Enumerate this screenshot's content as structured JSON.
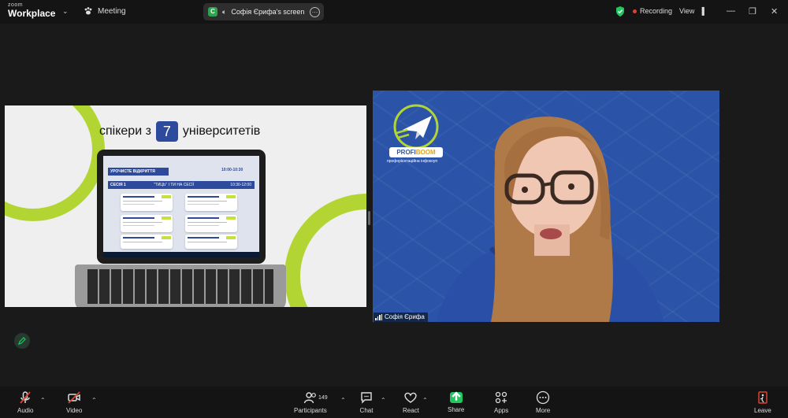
{
  "app": {
    "brand_top": "zoom",
    "brand_bottom": "Workplace",
    "meeting_label": "Meeting"
  },
  "share_pill": {
    "badge": "C",
    "label": "Софія Єрифа's screen"
  },
  "status": {
    "recording": "Recording",
    "view": "View"
  },
  "slide": {
    "headline_before": "спікери з",
    "headline_number": "7",
    "headline_after": "університетів",
    "screen_header": "УРОЧИСТЕ ВІДКРИТТЯ",
    "screen_time1": "10:00-10:30",
    "session_label": "СЕСІЯ 1",
    "session_title": "\"ТИЦЬ\" І ТИ НА СЕСІЇ",
    "session_time": "10:30-12:00"
  },
  "video": {
    "participant_name": "Софія Єрифа",
    "logo_word1": "PROFI",
    "logo_word2": "BOOM",
    "logo_sub": "профорієнтаційна інфокоуп"
  },
  "toolbar": {
    "audio": "Audio",
    "video": "Video",
    "participants": "Participants",
    "participants_count": "149",
    "chat": "Chat",
    "react": "React",
    "share": "Share",
    "apps": "Apps",
    "more": "More",
    "leave": "Leave"
  },
  "colors": {
    "accent_green": "#23c55e",
    "slide_lime": "#b3d534",
    "slide_blue": "#2d4a9c",
    "video_bg": "#2b54a8",
    "leave_red": "#e0412f"
  }
}
